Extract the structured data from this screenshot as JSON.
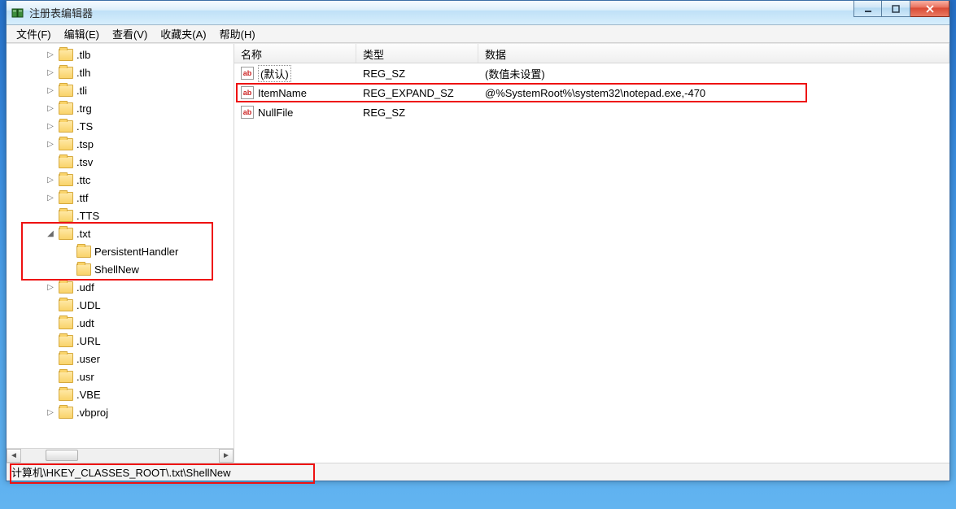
{
  "window": {
    "title": "注册表编辑器"
  },
  "menu": {
    "file": "文件(F)",
    "edit": "编辑(E)",
    "view": "查看(V)",
    "favorites": "收藏夹(A)",
    "help": "帮助(H)"
  },
  "tree": {
    "items": [
      {
        "label": ".tlb",
        "indent": 0,
        "expander": "▷"
      },
      {
        "label": ".tlh",
        "indent": 0,
        "expander": "▷"
      },
      {
        "label": ".tli",
        "indent": 0,
        "expander": "▷"
      },
      {
        "label": ".trg",
        "indent": 0,
        "expander": "▷"
      },
      {
        "label": ".TS",
        "indent": 0,
        "expander": "▷"
      },
      {
        "label": ".tsp",
        "indent": 0,
        "expander": "▷"
      },
      {
        "label": ".tsv",
        "indent": 0,
        "expander": ""
      },
      {
        "label": ".ttc",
        "indent": 0,
        "expander": "▷"
      },
      {
        "label": ".ttf",
        "indent": 0,
        "expander": "▷"
      },
      {
        "label": ".TTS",
        "indent": 0,
        "expander": ""
      },
      {
        "label": ".txt",
        "indent": 0,
        "expander": "◢"
      },
      {
        "label": "PersistentHandler",
        "indent": 1,
        "expander": ""
      },
      {
        "label": "ShellNew",
        "indent": 1,
        "expander": ""
      },
      {
        "label": ".udf",
        "indent": 0,
        "expander": "▷"
      },
      {
        "label": ".UDL",
        "indent": 0,
        "expander": ""
      },
      {
        "label": ".udt",
        "indent": 0,
        "expander": ""
      },
      {
        "label": ".URL",
        "indent": 0,
        "expander": ""
      },
      {
        "label": ".user",
        "indent": 0,
        "expander": ""
      },
      {
        "label": ".usr",
        "indent": 0,
        "expander": ""
      },
      {
        "label": ".VBE",
        "indent": 0,
        "expander": ""
      },
      {
        "label": ".vbproj",
        "indent": 0,
        "expander": "▷"
      }
    ]
  },
  "list": {
    "columns": {
      "name": "名称",
      "type": "类型",
      "data": "数据"
    },
    "rows": [
      {
        "name": "(默认)",
        "type": "REG_SZ",
        "data": "(数值未设置)",
        "default": true
      },
      {
        "name": "ItemName",
        "type": "REG_EXPAND_SZ",
        "data": "@%SystemRoot%\\system32\\notepad.exe,-470",
        "default": false
      },
      {
        "name": "NullFile",
        "type": "REG_SZ",
        "data": "",
        "default": false
      }
    ]
  },
  "status": {
    "path": "计算机\\HKEY_CLASSES_ROOT\\.txt\\ShellNew"
  }
}
